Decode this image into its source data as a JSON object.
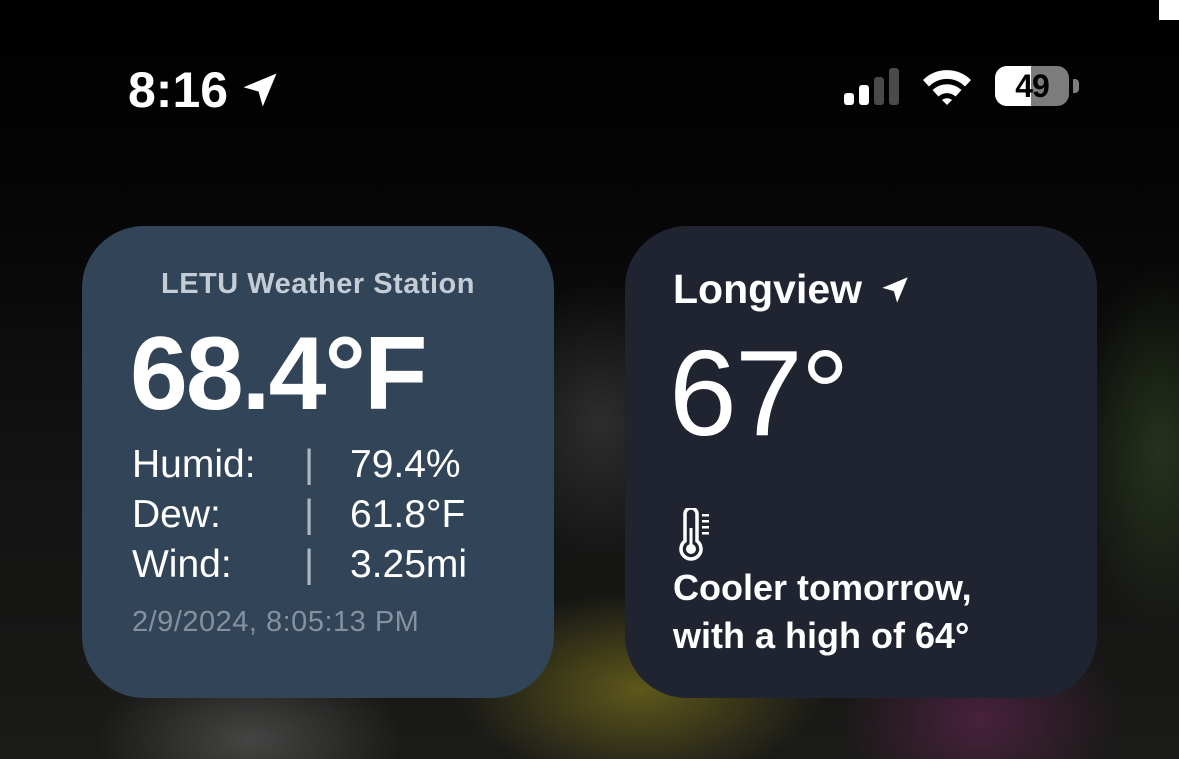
{
  "status_bar": {
    "time": "8:16",
    "battery_level": "49",
    "location_icon": "location-arrow-icon",
    "signal_icon": "cellular-signal-icon",
    "signal_bars_active": 2,
    "signal_bars_total": 4,
    "wifi_icon": "wifi-icon",
    "battery_icon": "battery-icon"
  },
  "station_widget": {
    "title": "LETU Weather Station",
    "temperature": "68.4°F",
    "rows": [
      {
        "label": "Humid:",
        "separator": "|",
        "value": "79.4%"
      },
      {
        "label": "Dew:",
        "separator": "|",
        "value": "61.8°F"
      },
      {
        "label": "Wind:",
        "separator": "|",
        "value": "3.25mi"
      }
    ],
    "updated": "2/9/2024, 8:05:13 PM",
    "background_color": "#324457"
  },
  "weather_widget": {
    "city": "Longview",
    "temperature": "67°",
    "forecast_line1": "Cooler tomorrow,",
    "forecast_line2": "with a high of 64°",
    "icon": "thermometer-icon",
    "location_icon": "location-arrow-icon",
    "background_color": "#1f2430"
  }
}
